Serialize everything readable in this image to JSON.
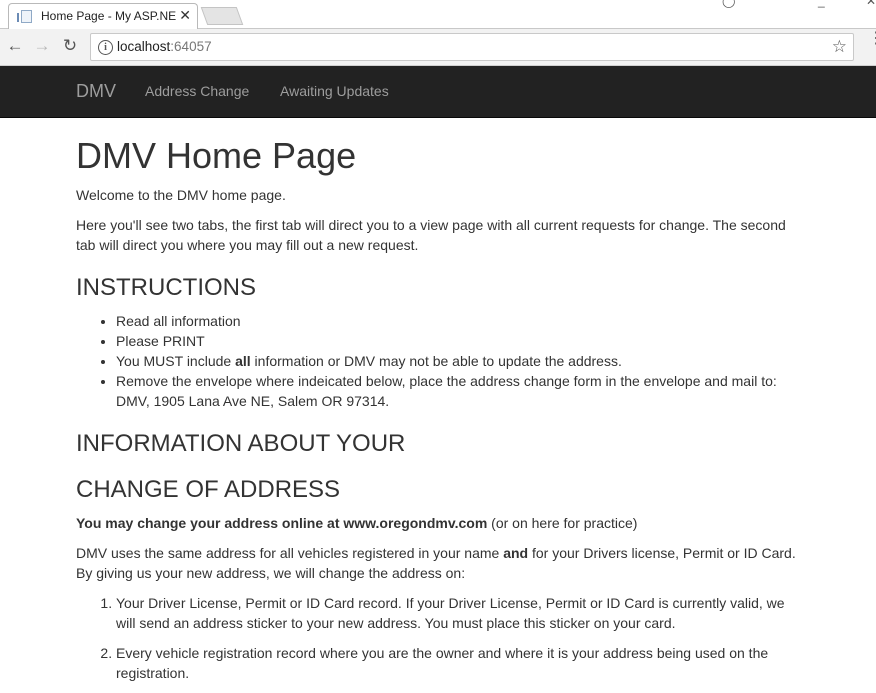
{
  "browser": {
    "tab_title": "Home Page - My ASP.NE",
    "url_host": "localhost",
    "url_port": ":64057"
  },
  "navbar": {
    "brand": "DMV",
    "links": [
      "Address Change",
      "Awaiting Updates"
    ]
  },
  "page": {
    "title": "DMV Home Page",
    "welcome": "Welcome to the DMV home page.",
    "intro": "Here you'll see two tabs, the first tab will direct you to a view page with all current requests for change. The second tab will direct you where you may fill out a new request.",
    "instructions_heading": "INSTRUCTIONS",
    "instructions": {
      "item1": "Read all information",
      "item2": "Please PRINT",
      "item3_before": "You MUST include ",
      "item3_bold": "all",
      "item3_after": " information or DMV may not be able to update the address.",
      "item4": "Remove the envelope where indeicated below, place the address change form in the envelope and mail to: DMV, 1905 Lana Ave NE, Salem OR 97314."
    },
    "info_heading_1": "INFORMATION ABOUT YOUR",
    "info_heading_2": "CHANGE OF ADDRESS",
    "online_bold": "You may change your address online at www.oregondmv.com",
    "online_rest": " (or on here for practice)",
    "vehicles_before": "DMV uses the same address for all vehicles registered in your name ",
    "vehicles_bold": "and",
    "vehicles_after": " for your Drivers license, Permit or ID Card. By giving us your new address, we will change the address on:",
    "ordered": [
      "Your Driver License, Permit or ID Card record. If your Driver License, Permit or ID Card is currently valid, we will send an address sticker to your new address. You must place this sticker on your card.",
      "Every vehicle registration record where you are the owner and where it is your address being used on the registration."
    ]
  }
}
